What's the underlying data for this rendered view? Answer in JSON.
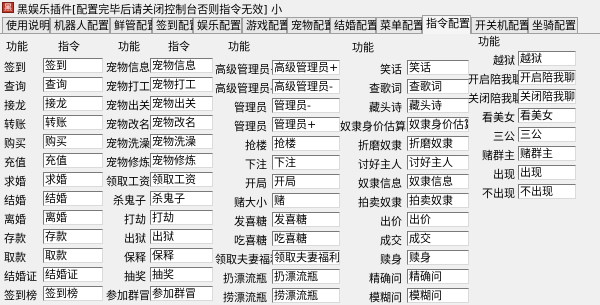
{
  "window": {
    "title": "黑娱乐插件[配置完毕后请关闭控制台否则指令无效] 小",
    "icon": "app-icon"
  },
  "tabs": [
    "使用说明",
    "机器人配置",
    "鲜管配置",
    "签到配置",
    "娱乐配置",
    "游戏配置",
    "宠物配置",
    "结婚配置",
    "菜单配置",
    "指令配置",
    "开关机配置",
    "坐骑配置"
  ],
  "active_tab": "指令配置",
  "panel": {
    "headers": [
      {
        "func": "功能",
        "cmd": "指令"
      },
      {
        "func": "功能",
        "cmd": "指令"
      },
      {
        "func": "功能",
        "cmd": ""
      },
      {
        "func": "功能",
        "cmd": ""
      },
      {
        "func": "功能",
        "cmd": ""
      }
    ],
    "groups": [
      [
        [
          "签到",
          "签到"
        ],
        [
          "查询",
          "查询"
        ],
        [
          "接龙",
          "接龙"
        ],
        [
          "转账",
          "转账"
        ],
        [
          "购买",
          "购买"
        ],
        [
          "充值",
          "充值"
        ],
        [
          "求婚",
          "求婚"
        ],
        [
          "结婚",
          "结婚"
        ],
        [
          "离婚",
          "离婚"
        ],
        [
          "存款",
          "存款"
        ],
        [
          "取款",
          "取款"
        ],
        [
          "结婚证",
          "结婚证"
        ],
        [
          "签到榜",
          "签到榜"
        ]
      ],
      [
        [
          "宠物信息",
          "宠物信息"
        ],
        [
          "宠物打工",
          "宠物打工"
        ],
        [
          "宠物出关",
          "宠物出关"
        ],
        [
          "宠物改名",
          "宠物改名"
        ],
        [
          "宠物洗澡",
          "宠物洗澡"
        ],
        [
          "宠物修炼",
          "宠物修炼"
        ],
        [
          "领取工资",
          "领取工资"
        ],
        [
          "杀鬼子",
          "杀鬼子"
        ],
        [
          "打劫",
          "打劫"
        ],
        [
          "出狱",
          "出狱"
        ],
        [
          "保释",
          "保释"
        ],
        [
          "抽奖",
          "抽奖"
        ],
        [
          "参加群冒",
          "参加群冒"
        ]
      ],
      [
        [
          "高级管理员+",
          "高级管理员+"
        ],
        [
          "高级管理员-",
          "高级管理员-"
        ],
        [
          "管理员",
          "管理员-"
        ],
        [
          "管理员",
          "管理员+"
        ],
        [
          "抢楼",
          "抢楼"
        ],
        [
          "下注",
          "下注"
        ],
        [
          "开局",
          "开局"
        ],
        [
          "赌大小",
          "赌"
        ],
        [
          "发喜糖",
          "发喜糖"
        ],
        [
          "吃喜糖",
          "吃喜糖"
        ],
        [
          "领取夫妻福利",
          "领取夫妻福利"
        ],
        [
          "扔漂流瓶",
          "扔漂流瓶"
        ],
        [
          "捞漂流瓶",
          "捞漂流瓶"
        ]
      ],
      [
        [
          "笑话",
          "笑话"
        ],
        [
          "查歌词",
          "查歌词"
        ],
        [
          "藏头诗",
          "藏头诗"
        ],
        [
          "奴隶身价估算",
          "奴隶身价估算"
        ],
        [
          "折磨奴隶",
          "折磨奴隶"
        ],
        [
          "讨好主人",
          "讨好主人"
        ],
        [
          "奴隶信息",
          "奴隶信息"
        ],
        [
          "拍卖奴隶",
          "拍卖奴隶"
        ],
        [
          "出价",
          "出价"
        ],
        [
          "成交",
          "成交"
        ],
        [
          "赎身",
          "赎身"
        ],
        [
          "精确问",
          "精确问"
        ],
        [
          "模糊问",
          "模糊问"
        ]
      ],
      [
        [
          "越狱",
          "越狱"
        ],
        [
          "开启陪我聊",
          "开启陪我聊"
        ],
        [
          "关闭陪我聊",
          "关闭陪我聊"
        ],
        [
          "看美女",
          "看美女"
        ],
        [
          "三公",
          "三公"
        ],
        [
          "赌群主",
          "赌群主"
        ],
        [
          "出现",
          "出现"
        ],
        [
          "不出现",
          "不出现"
        ]
      ]
    ]
  }
}
